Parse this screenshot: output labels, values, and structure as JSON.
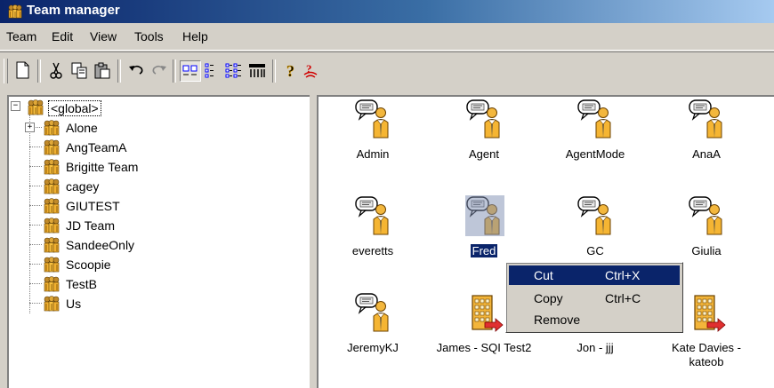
{
  "window": {
    "title": "Team manager"
  },
  "menu": [
    "Team",
    "Edit",
    "View",
    "Tools",
    "Help"
  ],
  "toolbar": {
    "buttons": [
      {
        "icon": "new-document-icon"
      },
      {
        "icon": "cut-icon"
      },
      {
        "icon": "copy-icon"
      },
      {
        "icon": "paste-icon"
      },
      {
        "icon": "undo-icon"
      },
      {
        "icon": "redo-icon"
      },
      {
        "icon": "large-icons-view-icon",
        "pressed": true
      },
      {
        "icon": "small-icons-view-icon"
      },
      {
        "icon": "list-view-icon"
      },
      {
        "icon": "details-view-icon"
      },
      {
        "icon": "help-icon"
      },
      {
        "icon": "whats-this-icon"
      }
    ]
  },
  "tree": {
    "root": "<global>",
    "children": [
      "Alone",
      "AngTeamA",
      "Brigitte Team",
      "cagey",
      "GIUTEST",
      "JD Team",
      "SandeeOnly",
      "Scoopie",
      "TestB",
      "Us"
    ]
  },
  "list": {
    "items": [
      {
        "label": "Admin",
        "icon": "agent-icon"
      },
      {
        "label": "Agent",
        "icon": "agent-icon"
      },
      {
        "label": "AgentMode",
        "icon": "agent-icon"
      },
      {
        "label": "AnaA",
        "icon": "agent-icon"
      },
      {
        "label": "everetts",
        "icon": "agent-icon"
      },
      {
        "label": "Fred",
        "icon": "agent-icon",
        "selected": true
      },
      {
        "label": "GC",
        "icon": "agent-icon"
      },
      {
        "label": "Giulia",
        "icon": "agent-icon"
      },
      {
        "label": "JeremyKJ",
        "icon": "agent-icon"
      },
      {
        "label": "James - SQI Test2",
        "icon": "building-icon"
      },
      {
        "label": "Jon - jjj",
        "icon": "building-icon"
      },
      {
        "label": "Kate Davies - kateob",
        "icon": "building-icon"
      }
    ]
  },
  "context_menu": [
    {
      "label": "Cut",
      "shortcut": "Ctrl+X",
      "highlighted": true
    },
    {
      "label": "Copy",
      "shortcut": "Ctrl+C"
    },
    {
      "label": "Remove",
      "shortcut": ""
    }
  ],
  "colors": {
    "titlebar": "#0a246a",
    "selection": "#0a246a",
    "face": "#d4d0c8"
  }
}
